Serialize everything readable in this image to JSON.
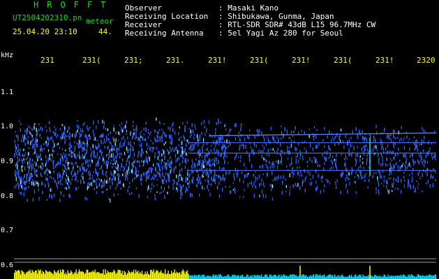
{
  "header": {
    "brand": "HROFFT",
    "file_name": "UT2504202310.pn",
    "meteor_label": "meteor",
    "datetime": "25.04.20 23:10",
    "count": "44."
  },
  "station_info": [
    {
      "label": "Observer",
      "value": ": Masaki Kano"
    },
    {
      "label": "Receiving Location",
      "value": ": Shibukawa, Gunma, Japan"
    },
    {
      "label": "Receiver",
      "value": ": RTL-SDR SDR# 43dB L15 96.7MHz CW"
    },
    {
      "label": "Receiving Antenna",
      "value": ": 5el Yagi Az 280 for Seoul"
    }
  ],
  "chart_data": {
    "type": "heatmap",
    "ylabel": "kHz",
    "y_ticks": [
      "1.1",
      "1.0",
      "0.9",
      "0.8",
      "0.7",
      "0.6"
    ],
    "y_values": [
      1.1,
      1.0,
      0.9,
      0.8,
      0.7,
      0.6
    ],
    "time_ticks": [
      "231",
      "231(",
      "231;",
      "231.",
      "231!",
      "231(",
      "231!",
      "231(",
      "231!",
      "2320"
    ],
    "ylim": [
      0.6,
      1.12
    ],
    "band_center_khz": 0.9,
    "carrier_lines_khz": [
      0.975,
      0.955,
      0.925,
      0.875
    ],
    "colors": {
      "signal": "#2a63ff",
      "bright": "#7fe8ff",
      "baseline": "#ffff00",
      "cyan": "#00dfff",
      "grid": "#a0a0a0"
    }
  }
}
